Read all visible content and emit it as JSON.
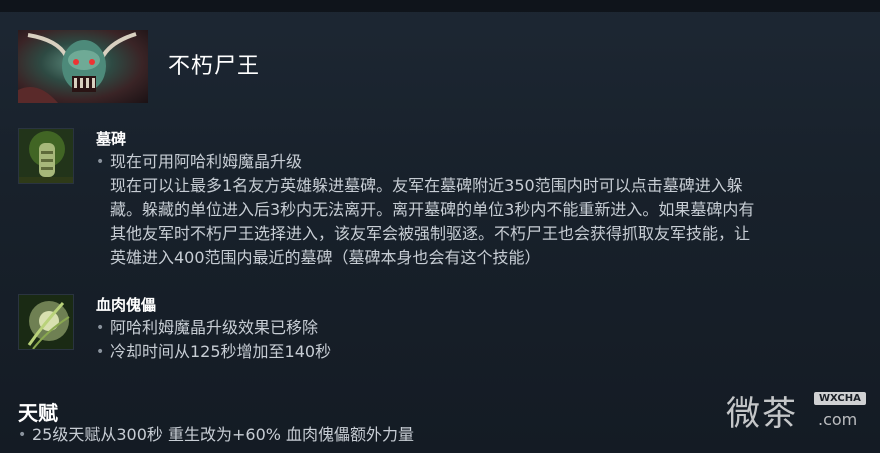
{
  "hero": {
    "name": "不朽尸王",
    "portrait_icon": "undying-portrait"
  },
  "abilities": [
    {
      "name": "墓碑",
      "icon": "tombstone-icon",
      "changes": [
        "现在可用阿哈利姆魔晶升级"
      ],
      "detail_lines": [
        "现在可以让最多1名友方英雄躲进墓碑。友军在墓碑附近350范围内时可以点击墓碑进入躲",
        "藏。躲藏的单位进入后3秒内无法离开。离开墓碑的单位3秒内不能重新进入。如果墓碑内有",
        "其他友军时不朽尸王选择进入，该友军会被强制驱逐。不朽尸王也会获得抓取友军技能，让",
        "英雄进入400范围内最近的墓碑（墓碑本身也会有这个技能）"
      ]
    },
    {
      "name": "血肉傀儡",
      "icon": "flesh-golem-icon",
      "changes": [
        "阿哈利姆魔晶升级效果已移除",
        "冷却时间从125秒增加至140秒"
      ]
    }
  ],
  "talents": {
    "title": "天赋",
    "changes": [
      "25级天赋从300秒 重生改为+60% 血肉傀儡额外力量"
    ]
  },
  "watermark": {
    "main": "微茶",
    "badge": "WXCHA",
    "domain": ".com"
  }
}
